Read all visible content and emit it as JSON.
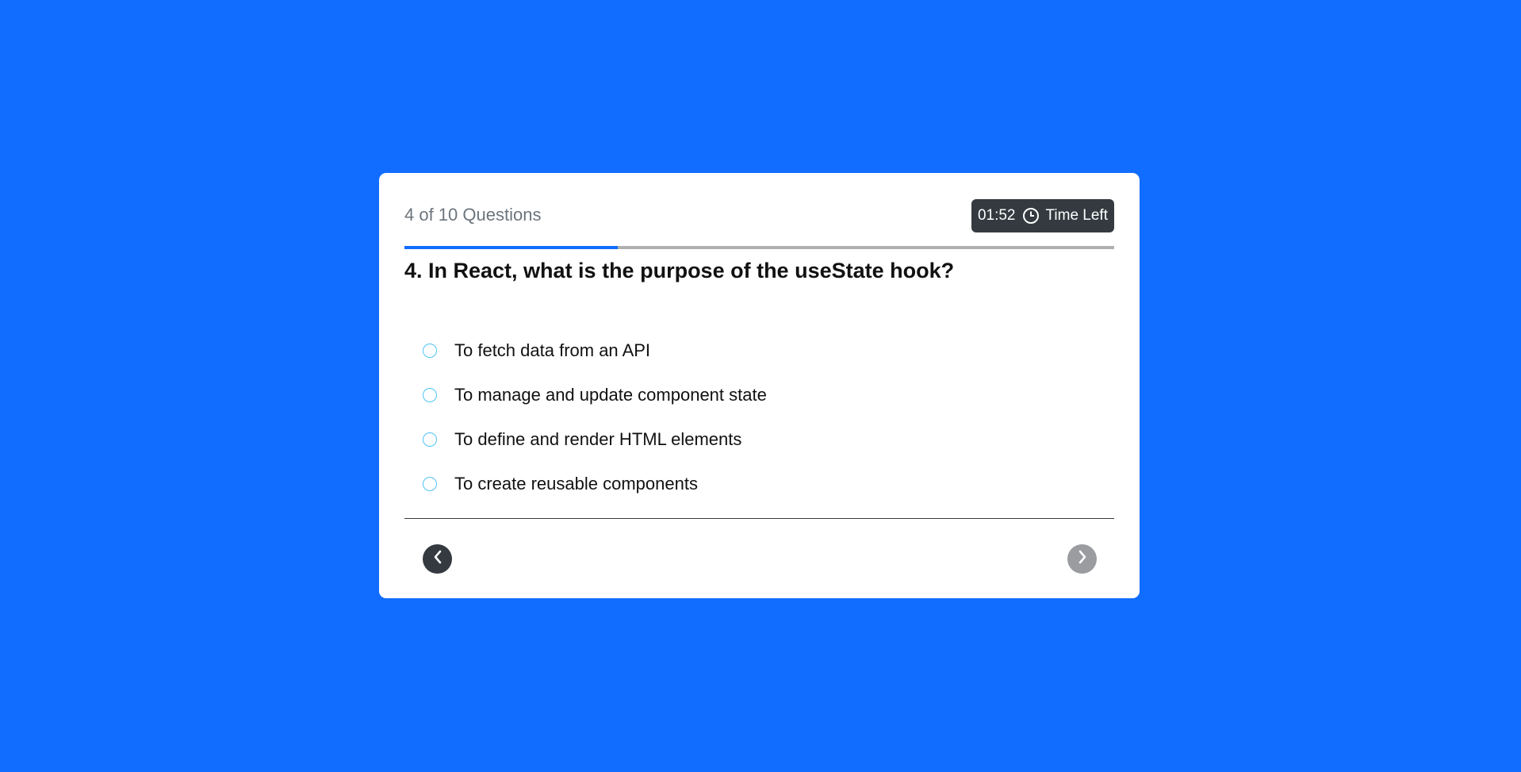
{
  "quiz": {
    "counter": "4 of 10 Questions",
    "timer": {
      "value": "01:52",
      "label": "Time Left",
      "icon": "clock-icon"
    },
    "progress_percent": 30,
    "question": "4. In React, what is the purpose of the useState hook?",
    "options": [
      "To fetch data from an API",
      "To manage and update component state",
      "To define and render HTML elements",
      "To create reusable components"
    ],
    "nav": {
      "prev_icon": "chevron-left-icon",
      "next_icon": "chevron-right-icon"
    }
  },
  "colors": {
    "background": "#116dff",
    "accent": "#116dff",
    "dark": "#343a40",
    "radio": "#4fc3f7"
  }
}
